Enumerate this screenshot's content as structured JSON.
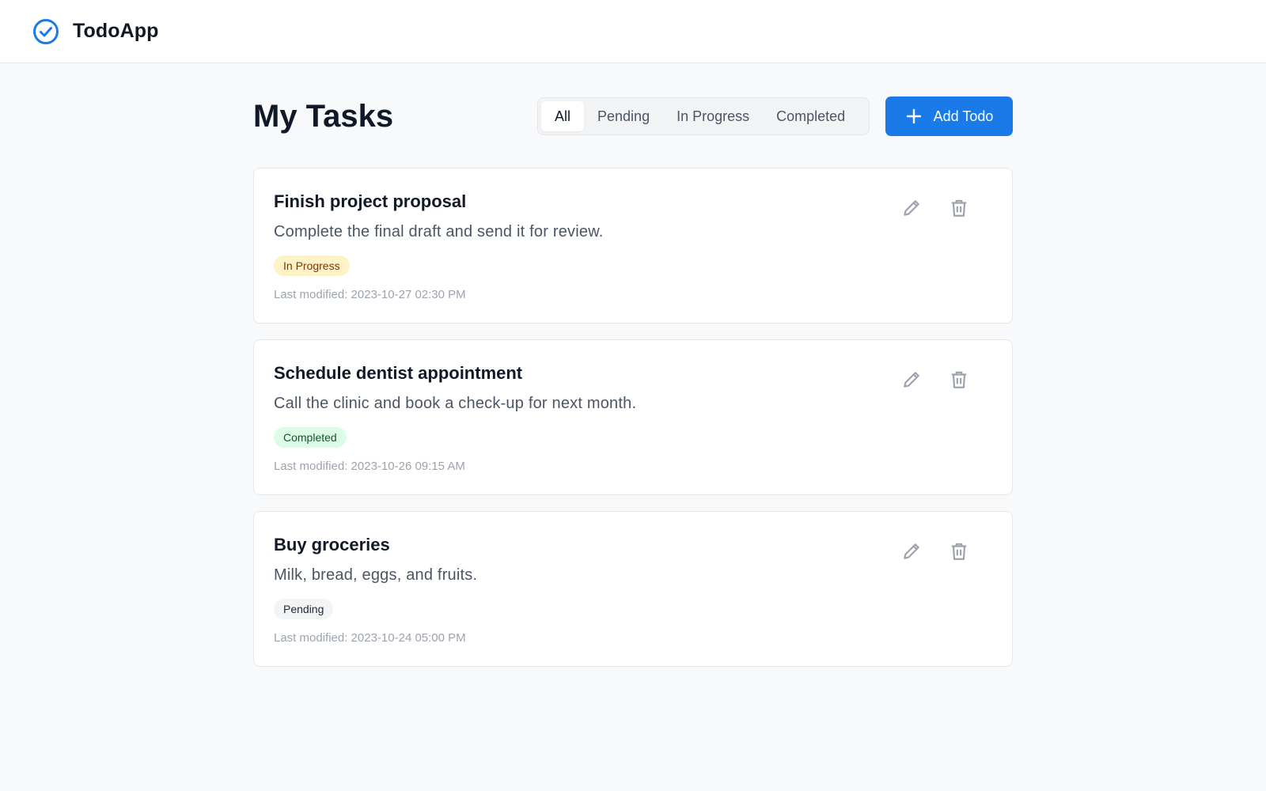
{
  "app": {
    "brand": "TodoApp",
    "logo_icon": "check-circle-icon",
    "accent": "#1a7be8"
  },
  "main": {
    "title": "My Tasks",
    "filters": [
      {
        "label": "All",
        "active": true
      },
      {
        "label": "Pending",
        "active": false
      },
      {
        "label": "In Progress",
        "active": false
      },
      {
        "label": "Completed",
        "active": false
      }
    ],
    "add_button": {
      "label": "Add Todo",
      "icon": "plus-icon"
    }
  },
  "tasks": [
    {
      "title": "Finish project proposal",
      "description": "Complete the final draft and send it for review.",
      "status": "In Progress",
      "status_color": "#fef3c7",
      "modified": "Last modified: 2023-10-27 02:30 PM"
    },
    {
      "title": "Schedule dentist appointment",
      "description": "Call the clinic and book a check-up for next month.",
      "status": "Completed",
      "status_color": "#dcfce7",
      "modified": "Last modified: 2023-10-26 09:15 AM"
    },
    {
      "title": "Buy groceries",
      "description": "Milk, bread, eggs, and fruits.",
      "status": "Pending",
      "status_color": "#f3f4f6",
      "modified": "Last modified: 2023-10-24 05:00 PM"
    }
  ],
  "task_actions": {
    "edit_icon": "pencil-icon",
    "delete_icon": "trash-icon"
  }
}
